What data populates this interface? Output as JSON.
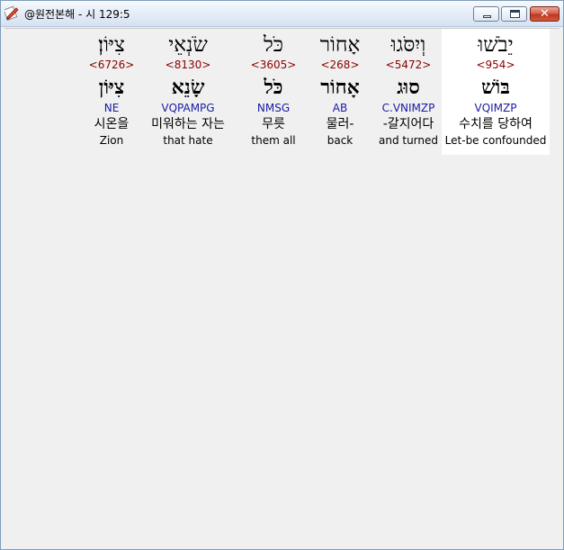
{
  "window": {
    "title": "@원전본해 - 시 129:5"
  },
  "words": [
    {
      "hebrew": "צִיּוֹן׃",
      "strong": "<6726>",
      "root": "צִיּוֹן",
      "parse": "NE",
      "korean": "시온을",
      "english": "Zion"
    },
    {
      "hebrew": "שֹׂנְאֵי",
      "strong": "<8130>",
      "root": "שָׂנֵא",
      "parse": "VQPAMPG",
      "korean": "미워하는 자는",
      "english": "that hate"
    },
    {
      "hebrew": "כֹּל",
      "strong": "<3605>",
      "root": "כֹּל",
      "parse": "NMSG",
      "korean": "무릇",
      "english": "them all"
    },
    {
      "hebrew": "אָחוֹר",
      "strong": "<268>",
      "root": "אָחוֹר",
      "parse": "AB",
      "korean": "물러-",
      "english": "back"
    },
    {
      "hebrew": "וְיִסֹּגוּ",
      "strong": "<5472>",
      "root": "סוּג",
      "parse": "C.VNIMZP",
      "korean": "-갈지어다",
      "english": "and turned"
    },
    {
      "hebrew": "יֵבֹשׁוּ",
      "strong": "<954>",
      "root": "בּוֹשׁ",
      "parse": "VQIMZP",
      "korean": "수치를 당하여",
      "english": "Let-be confounded"
    }
  ]
}
